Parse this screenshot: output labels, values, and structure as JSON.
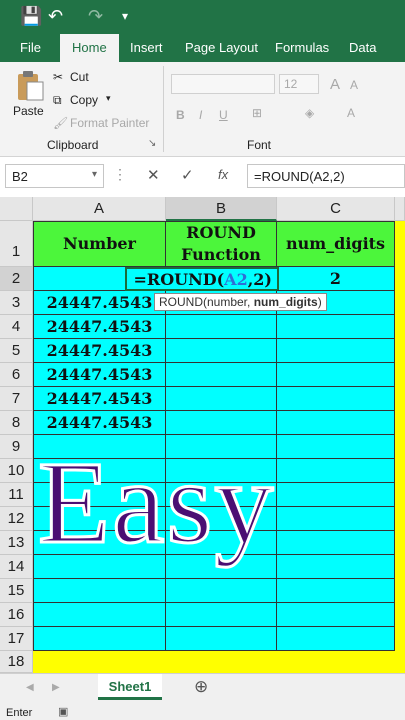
{
  "colors": {
    "excel_green": "#217346",
    "header_cell": "#4cf63b",
    "data_cell": "#00ffff",
    "highlight": "#ffff00",
    "easy_text": "#4b0f73"
  },
  "quick_access": {
    "save": "💾",
    "undo": "↶",
    "redo": "↷",
    "more": "▾"
  },
  "tabs": [
    "File",
    "Home",
    "Insert",
    "Page Layout",
    "Formulas",
    "Data"
  ],
  "ribbon": {
    "paste": "Paste",
    "cut": "Cut",
    "copy": "Copy",
    "format_painter": "Format Painter",
    "clipboard_group": "Clipboard",
    "font_group": "Font",
    "font_size": "12",
    "bold": "B",
    "italic": "I",
    "underline": "U"
  },
  "formula_bar": {
    "name_box": "B2",
    "cancel": "✕",
    "enter": "✓",
    "fx": "fx",
    "formula": "=ROUND(A2,2)"
  },
  "columns": [
    "A",
    "B",
    "C"
  ],
  "rows": [
    "1",
    "2",
    "3",
    "4",
    "5",
    "6",
    "7",
    "8",
    "9",
    "10",
    "11",
    "12",
    "13",
    "14",
    "15",
    "16",
    "17",
    "18"
  ],
  "headers": {
    "a": "Number",
    "b": "ROUND Function",
    "c": "num_digits"
  },
  "row2": {
    "formula_prefix": "=ROUND(",
    "formula_ref": "A2",
    "formula_suffix": ",2)",
    "c": "2"
  },
  "numbers": [
    "24447.4543",
    "24447.4543",
    "24447.4543",
    "24447.4543",
    "24447.4543",
    "24447.4543"
  ],
  "tooltip": {
    "prefix": "ROUND(number, ",
    "bold": "num_digits",
    "suffix": ")"
  },
  "overlay_text": "Easy",
  "sheet_tab": "Sheet1",
  "add_sheet": "⊕",
  "status": "Enter"
}
